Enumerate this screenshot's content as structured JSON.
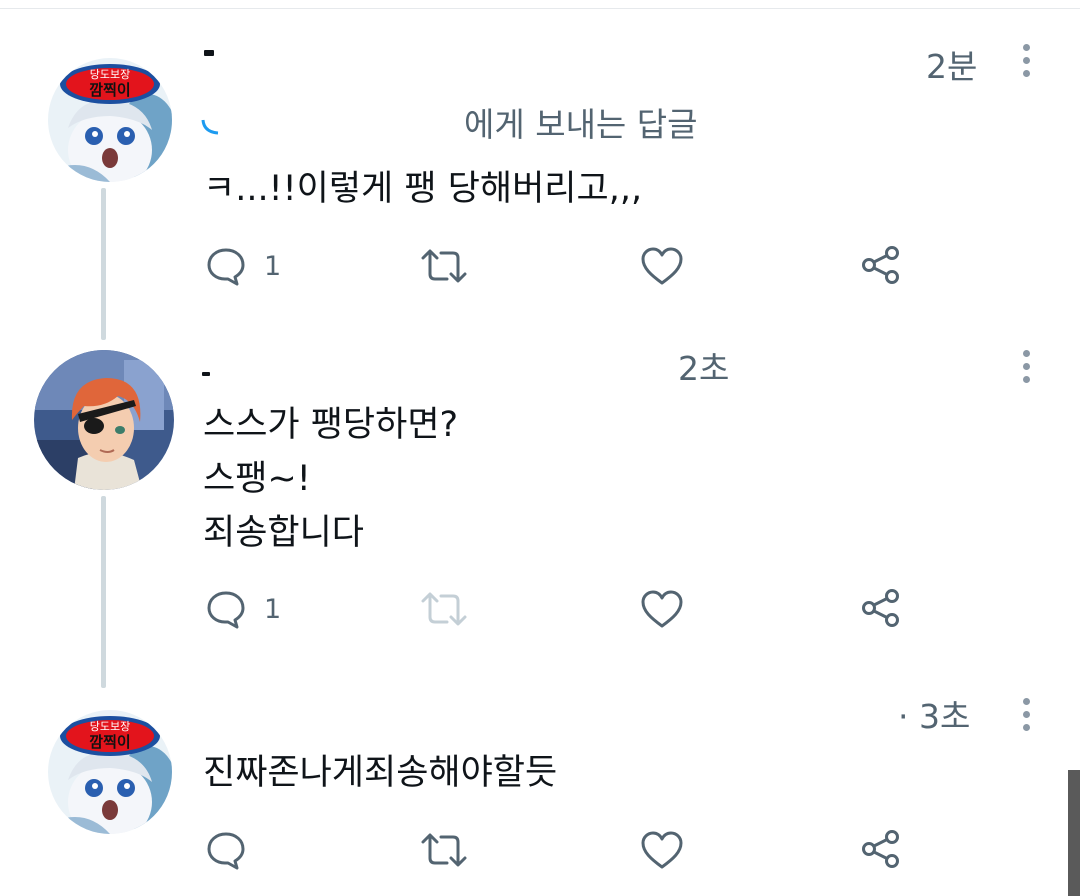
{
  "tweets": [
    {
      "time": "2분",
      "replying_to": "에게 보내는 답글",
      "lines": [
        "ㅋ...!!이렇게 팽 당해버리고,,,"
      ],
      "reply_count": "1",
      "avatar_badge_top": "당도보장",
      "avatar_badge_main": "깜찍이"
    },
    {
      "time": "2초",
      "lines": [
        "스스가 팽당하면?",
        "스팽~!",
        "죄송합니다"
      ],
      "reply_count": "1"
    },
    {
      "time": "· 3초",
      "lines": [
        "진짜존나게죄송해야할듯"
      ],
      "reply_count": "",
      "avatar_badge_top": "당도보장",
      "avatar_badge_main": "깜찍이"
    }
  ],
  "icons": {
    "reply": "reply-bubble-icon",
    "retweet": "retweet-arrows-icon",
    "like": "heart-icon",
    "share": "share-nodes-icon",
    "more": "vertical-ellipsis-icon"
  },
  "colors": {
    "text": "#0f1419",
    "secondary": "#536471",
    "icon": "#536471",
    "thread_line": "#cfd9de",
    "badge_red": "#e3141c",
    "badge_blue": "#1c4fa0"
  }
}
